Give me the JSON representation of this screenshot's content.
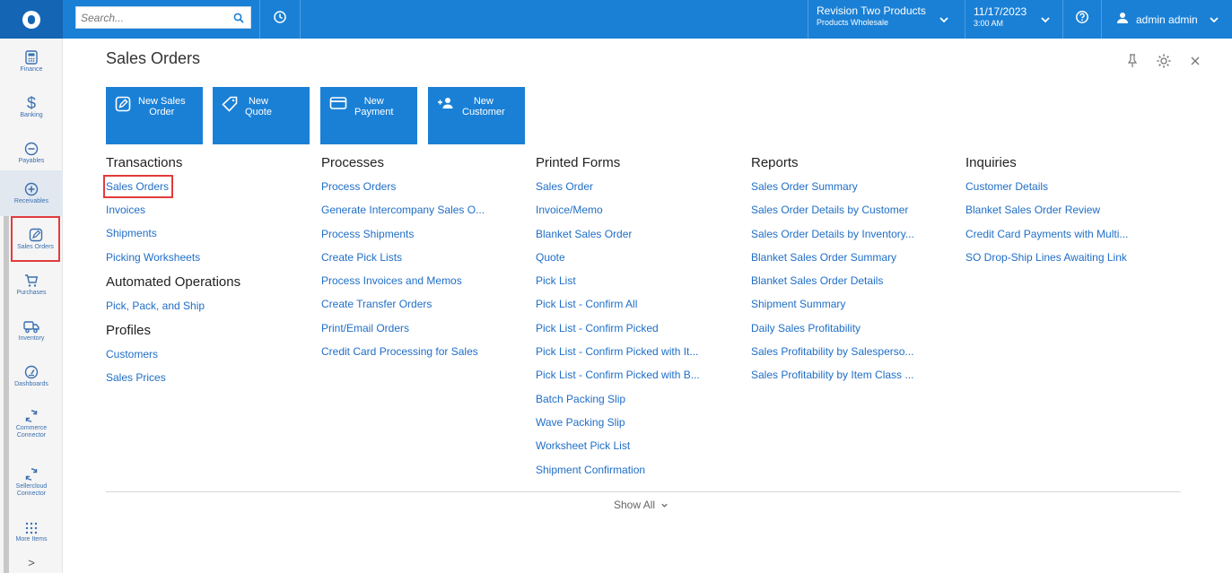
{
  "topbar": {
    "search_placeholder": "Search...",
    "company_name": "Revision Two Products",
    "company_branch": "Products Wholesale",
    "date": "11/17/2023",
    "time": "3:00 AM",
    "user_name": "admin admin"
  },
  "sidebar": {
    "items": [
      {
        "label": "Finance",
        "icon": "calculator-icon"
      },
      {
        "label": "Banking",
        "icon": "dollar-icon"
      },
      {
        "label": "Payables",
        "icon": "minus-circle-icon"
      },
      {
        "label": "Receivables",
        "icon": "plus-circle-icon"
      },
      {
        "label": "Sales Orders",
        "icon": "pencil-square-icon"
      },
      {
        "label": "Purchases",
        "icon": "cart-icon"
      },
      {
        "label": "Inventory",
        "icon": "truck-icon"
      },
      {
        "label": "Dashboards",
        "icon": "gauge-icon"
      },
      {
        "label": "Commerce Connector",
        "icon": "sync-icon"
      },
      {
        "label": "Sellercloud Connector",
        "icon": "sync-icon"
      },
      {
        "label": "More Items",
        "icon": "grid-icon"
      }
    ],
    "expand_glyph": ">"
  },
  "page": {
    "title": "Sales Orders",
    "show_all": "Show All"
  },
  "tiles": [
    {
      "label_line1": "New Sales",
      "label_line2": "Order",
      "icon": "pencil-icon"
    },
    {
      "label_line1": "New",
      "label_line2": "Quote",
      "icon": "tag-icon"
    },
    {
      "label_line1": "New",
      "label_line2": "Payment",
      "icon": "card-icon"
    },
    {
      "label_line1": "New",
      "label_line2": "Customer",
      "icon": "add-user-icon"
    }
  ],
  "columns": {
    "transactions": {
      "heading": "Transactions",
      "links": [
        "Sales Orders",
        "Invoices",
        "Shipments",
        "Picking Worksheets"
      ]
    },
    "automated": {
      "heading": "Automated Operations",
      "links": [
        "Pick, Pack, and Ship"
      ]
    },
    "profiles": {
      "heading": "Profiles",
      "links": [
        "Customers",
        "Sales Prices"
      ]
    },
    "processes": {
      "heading": "Processes",
      "links": [
        "Process Orders",
        "Generate Intercompany Sales O...",
        "Process Shipments",
        "Create Pick Lists",
        "Process Invoices and Memos",
        "Create Transfer Orders",
        "Print/Email Orders",
        "Credit Card Processing for Sales"
      ]
    },
    "printed_forms": {
      "heading": "Printed Forms",
      "links": [
        "Sales Order",
        "Invoice/Memo",
        "Blanket Sales Order",
        "Quote",
        "Pick List",
        "Pick List - Confirm All",
        "Pick List - Confirm Picked",
        "Pick List - Confirm Picked with It...",
        "Pick List - Confirm Picked with B...",
        "Batch Packing Slip",
        "Wave Packing Slip",
        "Worksheet Pick List",
        "Shipment Confirmation"
      ]
    },
    "reports": {
      "heading": "Reports",
      "links": [
        "Sales Order Summary",
        "Sales Order Details by Customer",
        "Sales Order Details by Inventory...",
        "Blanket Sales Order Summary",
        "Blanket Sales Order Details",
        "Shipment Summary",
        "Daily Sales Profitability",
        "Sales Profitability by Salesperso...",
        "Sales Profitability by Item Class ..."
      ]
    },
    "inquiries": {
      "heading": "Inquiries",
      "links": [
        "Customer Details",
        "Blanket Sales Order Review",
        "Credit Card Payments with Multi...",
        "SO Drop-Ship Lines Awaiting Link"
      ]
    }
  },
  "colors": {
    "topbar": "#1a80d6",
    "accent": "#1a80d6",
    "link": "#1f6ec7",
    "highlight": "#e23b3b"
  }
}
